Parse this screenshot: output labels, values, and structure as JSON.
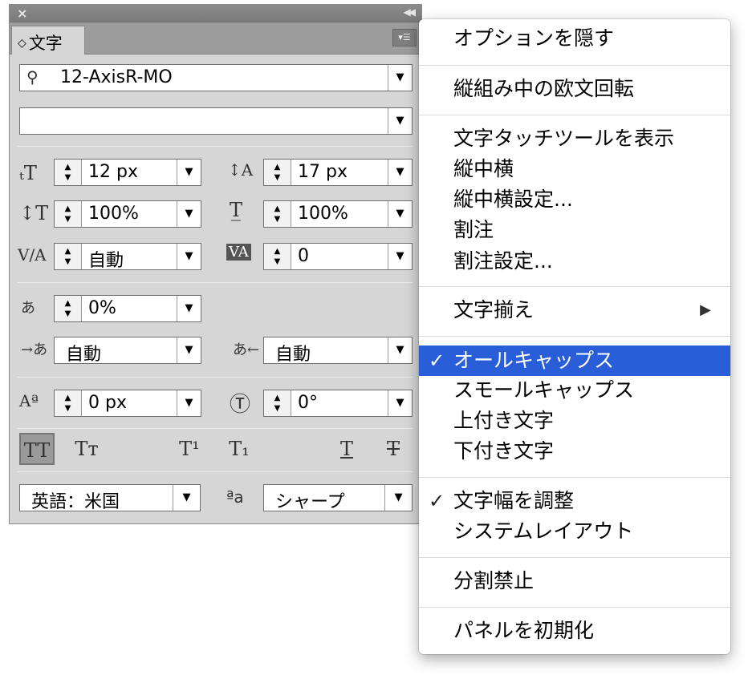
{
  "panel": {
    "tab_label": "文字",
    "font_name": "12-AxisR-MO",
    "font_style": "",
    "font_size": "12 px",
    "leading": "17 px",
    "vertical_scale": "100%",
    "horizontal_scale": "100%",
    "kerning": "自動",
    "tracking": "0",
    "tsume": "0%",
    "aki_left": "自動",
    "aki_right": "自動",
    "baseline_shift": "0 px",
    "rotation": "0°",
    "language": "英語：米国",
    "antialias": "シャープ",
    "antialias_icon": "ªa",
    "style_buttons": [
      "TT",
      "Tт",
      "T¹",
      "T₁",
      "T",
      "T"
    ]
  },
  "menu": {
    "items": [
      {
        "label": "オプションを隠す"
      },
      {
        "label": "縦組み中の欧文回転"
      },
      {
        "label": "文字タッチツールを表示"
      },
      {
        "label": "縦中横"
      },
      {
        "label": "縦中横設定..."
      },
      {
        "label": "割注"
      },
      {
        "label": "割注設定..."
      },
      {
        "label": "文字揃え",
        "submenu_arrow": "▶"
      },
      {
        "label": "オールキャップス",
        "check": "✓"
      },
      {
        "label": "スモールキャップス"
      },
      {
        "label": "上付き文字"
      },
      {
        "label": "下付き文字"
      },
      {
        "label": "文字幅を調整",
        "check": "✓"
      },
      {
        "label": "システムレイアウト"
      },
      {
        "label": "分割禁止"
      },
      {
        "label": "パネルを初期化"
      }
    ]
  },
  "colors": {
    "panel_bg": "#d6d6d6",
    "highlight": "#2a5ed8",
    "titlebar": "#858585"
  }
}
